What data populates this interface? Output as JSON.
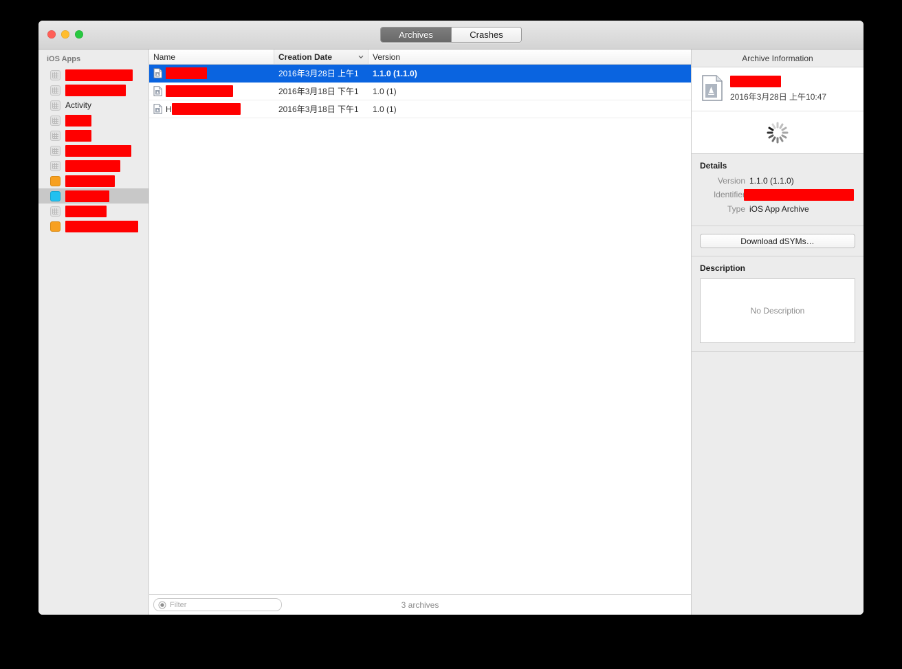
{
  "window": {
    "traffic_lights": [
      "close",
      "minimize",
      "zoom"
    ]
  },
  "toolbar": {
    "tabs": [
      {
        "label": "Archives",
        "active": true
      },
      {
        "label": "Crashes",
        "active": false
      }
    ]
  },
  "sidebar": {
    "title": "iOS Apps",
    "items": [
      {
        "label": "",
        "icon": "app-grid-icon",
        "redacted": true,
        "redact_width": 98,
        "selected": false
      },
      {
        "label": "",
        "icon": "app-grid-icon",
        "redacted": true,
        "redact_width": 88,
        "selected": false
      },
      {
        "label": "Activity",
        "icon": "app-grid-icon",
        "redacted": false,
        "redact_width": 0,
        "selected": false
      },
      {
        "label": "",
        "icon": "app-grid-icon",
        "redacted": true,
        "redact_width": 38,
        "selected": false
      },
      {
        "label": "",
        "icon": "app-grid-icon",
        "redacted": true,
        "redact_width": 38,
        "selected": false
      },
      {
        "label": "",
        "icon": "app-grid-icon",
        "redacted": true,
        "redact_width": 96,
        "selected": false
      },
      {
        "label": "",
        "icon": "app-grid-icon",
        "redacted": true,
        "redact_width": 80,
        "selected": false
      },
      {
        "label": "",
        "icon": "app-orange-icon",
        "redacted": true,
        "redact_width": 72,
        "selected": false
      },
      {
        "label": "",
        "icon": "app-cyan-icon",
        "redacted": true,
        "redact_width": 64,
        "selected": true
      },
      {
        "label": "",
        "icon": "app-grid-icon",
        "redacted": true,
        "redact_width": 60,
        "selected": false
      },
      {
        "label": "",
        "icon": "app-orange-icon",
        "redacted": true,
        "redact_width": 106,
        "selected": false
      }
    ]
  },
  "table": {
    "columns": [
      {
        "key": "name",
        "label": "Name",
        "sorted": false
      },
      {
        "key": "date",
        "label": "Creation Date",
        "sorted": true,
        "sort_icon": "chevron-down-icon"
      },
      {
        "key": "version",
        "label": "Version",
        "sorted": false
      }
    ],
    "rows": [
      {
        "name": "",
        "name_prefix": "",
        "name_redact_width": 60,
        "date": "2016年3月28日 上午1",
        "version": "1.1.0 (1.1.0)",
        "icon": "archive-document-icon",
        "selected": true
      },
      {
        "name": "",
        "name_prefix": "",
        "name_redact_width": 98,
        "date": "2016年3月18日 下午1",
        "version": "1.0 (1)",
        "icon": "archive-document-icon",
        "selected": false
      },
      {
        "name": "",
        "name_prefix": "H",
        "name_redact_width": 100,
        "date": "2016年3月18日 下午1",
        "version": "1.0 (1)",
        "icon": "archive-document-icon",
        "selected": false
      }
    ]
  },
  "bottom_bar": {
    "filter_placeholder": "Filter",
    "filter_value": "",
    "filter_icon": "filter-circle-icon",
    "status": "3 archives"
  },
  "inspector": {
    "title": "Archive Information",
    "archive_icon": "archive-app-icon",
    "archive_name": "",
    "archive_name_redact_width": 74,
    "archive_date": "2016年3月28日 上午10:47",
    "loading_icon": "spinner-icon",
    "details": {
      "title": "Details",
      "fields": [
        {
          "label": "Version",
          "value": "1.1.0 (1.1.0)",
          "redacted": false,
          "redact_width": 0
        },
        {
          "label": "Identifier",
          "value": "",
          "redacted": true,
          "redact_width": 160
        },
        {
          "label": "Type",
          "value": "iOS App Archive",
          "redacted": false,
          "redact_width": 0
        }
      ]
    },
    "download_button": "Download dSYMs…",
    "description": {
      "title": "Description",
      "placeholder": "No Description"
    }
  },
  "colors": {
    "accent_selection": "#0a64e0",
    "redaction": "#ff0000",
    "sidebar_bg": "#ececec",
    "window_bg": "#ececec"
  }
}
